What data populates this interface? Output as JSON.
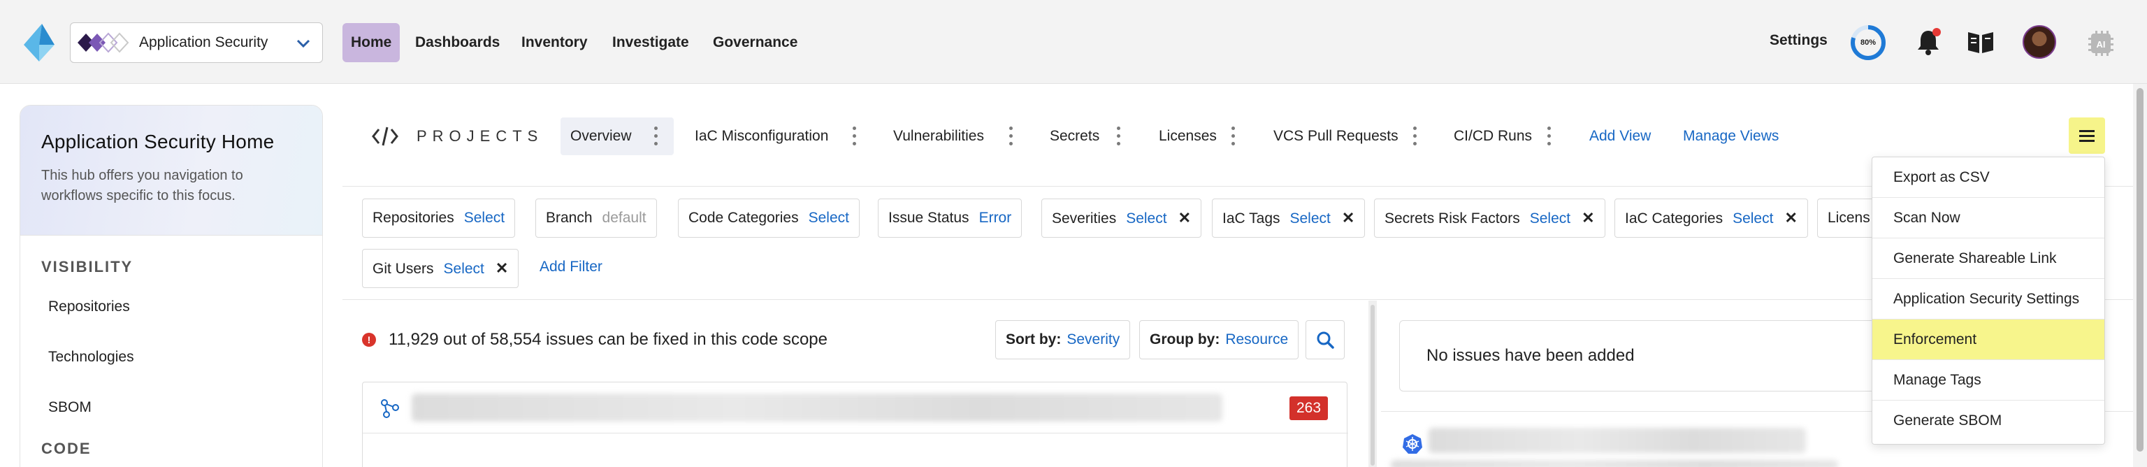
{
  "topnav": {
    "app_name": "Application Security",
    "items": [
      "Home",
      "Dashboards",
      "Inventory",
      "Investigate",
      "Governance"
    ],
    "active_index": 0,
    "settings_label": "Settings",
    "progress_label": "80%",
    "progress_value": 0.8,
    "icons": [
      "logo-icon",
      "app-brand-icon",
      "chevron-down-icon",
      "bell-icon",
      "book-icon",
      "avatar",
      "ai-icon"
    ]
  },
  "hub": {
    "title": "Application Security Home",
    "description": "This hub offers you navigation to workflows specific to this focus.",
    "sections": [
      {
        "title": "VISIBILITY",
        "items": [
          "Repositories",
          "Technologies",
          "SBOM"
        ]
      },
      {
        "title": "CODE",
        "items": []
      }
    ]
  },
  "projects": {
    "title": "PROJECTS",
    "tabs": [
      "Overview",
      "IaC Misconfiguration",
      "Vulnerabilities",
      "Secrets",
      "Licenses",
      "VCS Pull Requests",
      "CI/CD Runs"
    ],
    "active_tab": 0,
    "add_view": "Add View",
    "manage_views": "Manage Views"
  },
  "filters": [
    {
      "label": "Repositories",
      "value": "Select",
      "removable": false
    },
    {
      "label": "Branch",
      "value": "default",
      "muted": true,
      "removable": false
    },
    {
      "label": "Code Categories",
      "value": "Select",
      "removable": false
    },
    {
      "label": "Issue Status",
      "value": "Error",
      "removable": false
    },
    {
      "label": "Severities",
      "value": "Select",
      "removable": true
    },
    {
      "label": "IaC Tags",
      "value": "Select",
      "removable": true
    },
    {
      "label": "Secrets Risk Factors",
      "value": "Select",
      "removable": true
    },
    {
      "label": "IaC Categories",
      "value": "Select",
      "removable": true
    },
    {
      "label": "Licens",
      "value": "",
      "removable": false
    },
    {
      "label": "Git Users",
      "value": "Select",
      "removable": true
    }
  ],
  "add_filter": "Add Filter",
  "summary": {
    "alert_glyph": "!",
    "text": "11,929 out of 58,554 issues can be fixed in this code scope",
    "sort_label": "Sort by:",
    "sort_value": "Severity",
    "group_label": "Group by:",
    "group_value": "Resource"
  },
  "issue_card": {
    "count": "263"
  },
  "right_panel": {
    "empty_text": "No issues have been added"
  },
  "menu": {
    "items": [
      "Export as CSV",
      "Scan Now",
      "Generate Shareable Link",
      "Application Security Settings",
      "Enforcement",
      "Manage Tags",
      "Generate SBOM"
    ],
    "highlighted_index": 4
  },
  "colors": {
    "accent_blue": "#1767c4",
    "active_nav": "#c9b6de",
    "highlight": "#f7f58c",
    "danger": "#d3312b"
  }
}
